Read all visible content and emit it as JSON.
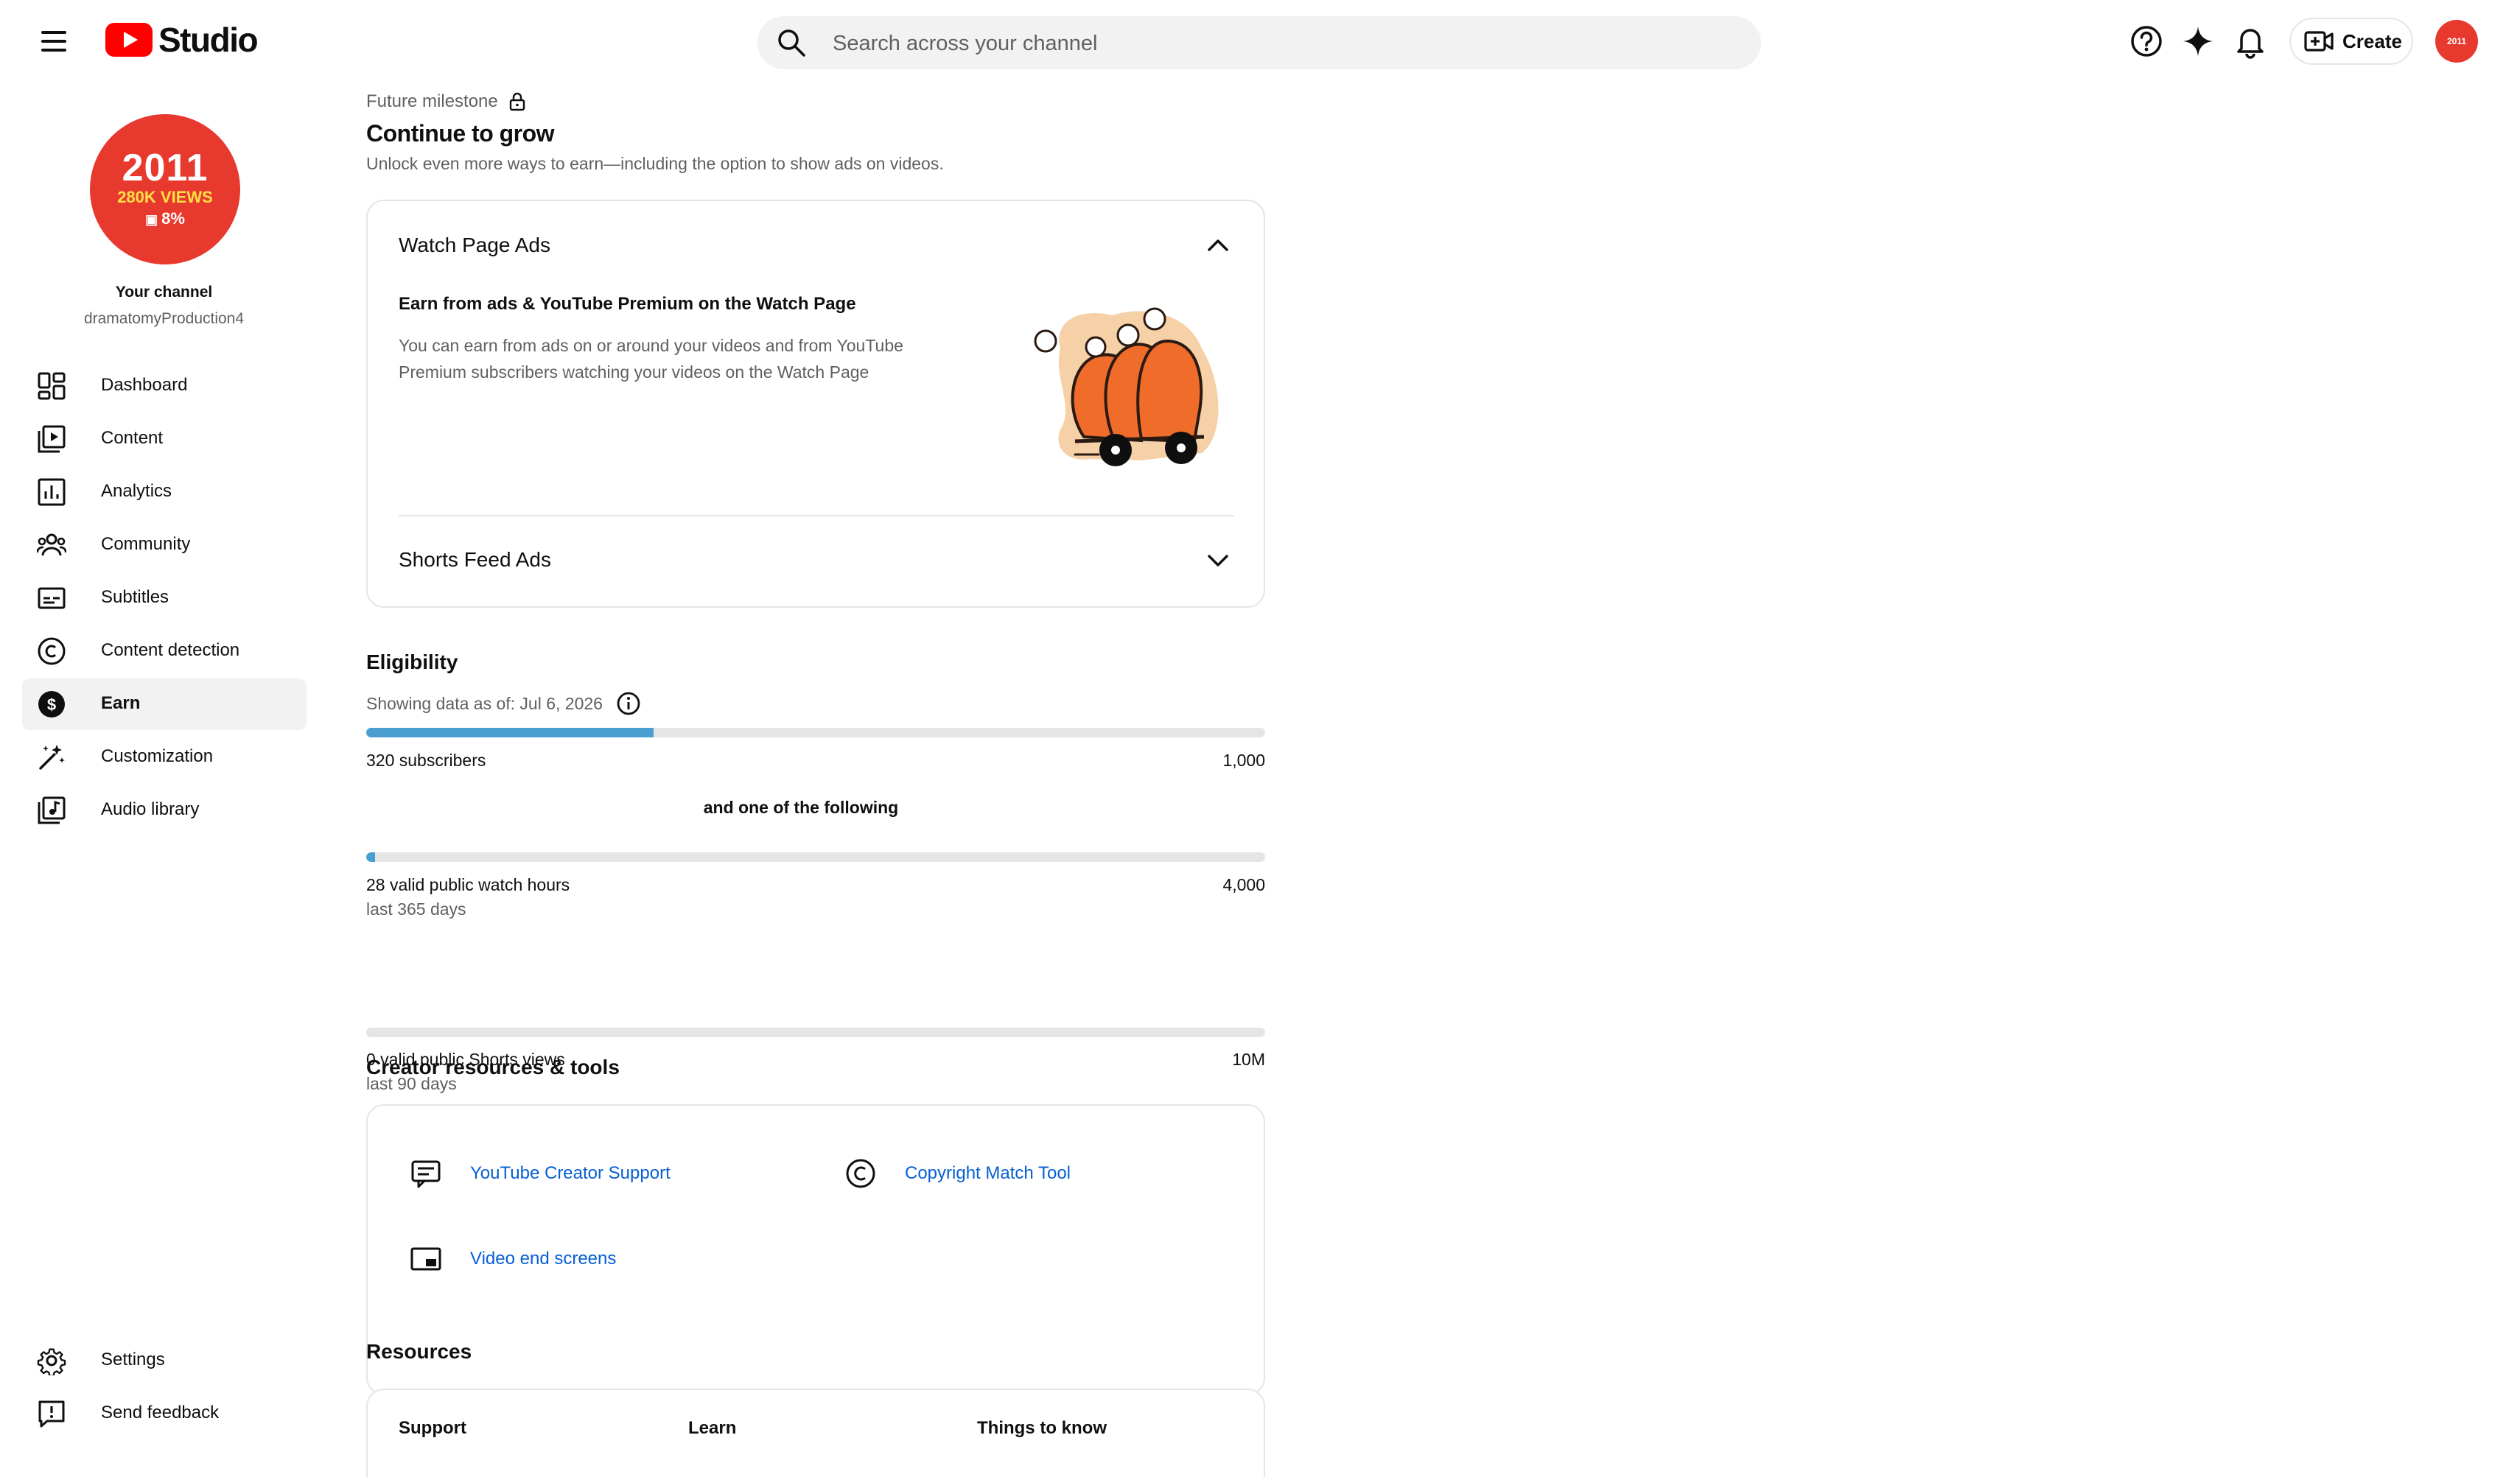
{
  "header": {
    "menu_icon": "hamburger-menu-icon",
    "logo_text": "Studio",
    "search_placeholder": "Search across your channel",
    "create_label": "Create",
    "avatar_text": "2011",
    "brand_color": "#ff0000"
  },
  "sidebar": {
    "avatar": {
      "year": "2011",
      "views": "280K VIEWS",
      "percent": "8%"
    },
    "channel_label": "Your channel",
    "channel_handle": "dramatomyProduction4",
    "items": [
      {
        "label": "Dashboard",
        "icon": "dashboard-icon"
      },
      {
        "label": "Content",
        "icon": "content-icon"
      },
      {
        "label": "Analytics",
        "icon": "analytics-icon"
      },
      {
        "label": "Community",
        "icon": "community-icon"
      },
      {
        "label": "Subtitles",
        "icon": "subtitles-icon"
      },
      {
        "label": "Content detection",
        "icon": "copyright-icon"
      },
      {
        "label": "Earn",
        "icon": "earn-dollar-icon",
        "active": true
      },
      {
        "label": "Customization",
        "icon": "magic-wand-icon"
      },
      {
        "label": "Audio library",
        "icon": "audio-library-icon"
      }
    ],
    "bottom_items": [
      {
        "label": "Settings",
        "icon": "gear-icon"
      },
      {
        "label": "Send feedback",
        "icon": "feedback-icon"
      }
    ]
  },
  "milestone": {
    "label": "Future milestone",
    "title": "Continue to grow",
    "subtitle": "Unlock even more ways to earn—including the option to show ads on videos."
  },
  "watch_ads": {
    "title": "Watch Page Ads",
    "subtitle": "Earn from ads & YouTube Premium on the Watch Page",
    "description": "You can earn from ads on or around your videos and from YouTube Premium subscribers watching your videos on the Watch Page"
  },
  "shorts_ads": {
    "title": "Shorts Feed Ads"
  },
  "eligibility": {
    "title": "Eligibility",
    "date_text": "Showing data as of: Jul 6, 2026",
    "subscribers": {
      "label": "320 subscribers",
      "max": "1,000",
      "progress": 0.32
    },
    "connector": "and one of the following",
    "watch_hours": {
      "label": "28 valid public watch hours",
      "sub": "last 365 days",
      "max": "4,000",
      "progress": 0.007
    },
    "shorts_views": {
      "label": "0 valid public Shorts views",
      "sub": "last 90 days",
      "max": "10M",
      "progress": 0
    },
    "bar_color": "#4b9ed1"
  },
  "tools": {
    "title": "Creator resources & tools",
    "items": [
      {
        "label": "YouTube Creator Support",
        "icon": "chat-support-icon"
      },
      {
        "label": "Copyright Match Tool",
        "icon": "copyright-icon"
      },
      {
        "label": "Video end screens",
        "icon": "end-screen-icon"
      }
    ],
    "link_color": "#065fd4"
  },
  "resources": {
    "title": "Resources",
    "columns": [
      "Support",
      "Learn",
      "Things to know"
    ]
  }
}
